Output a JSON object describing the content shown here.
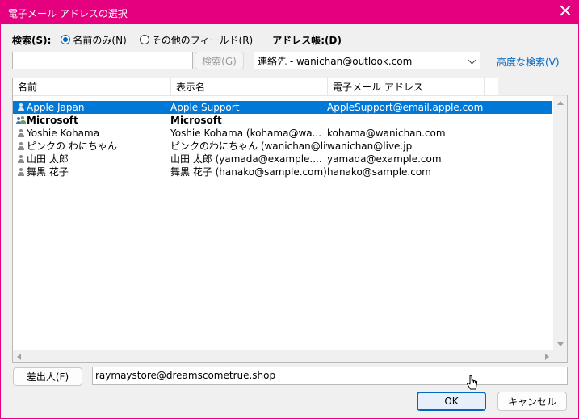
{
  "window": {
    "title": "電子メール アドレスの選択",
    "title_bar_color": "#e4007f"
  },
  "search": {
    "label": "検索(S):",
    "option_name_only": "名前のみ(N)",
    "option_other_fields": "その他のフィールド(R)",
    "selected_option": "名前のみ(N)",
    "input_value": "",
    "search_button": "検索(G)"
  },
  "address_book": {
    "label": "アドレス帳:(D)",
    "selected": "連絡先 - wanichan@outlook.com",
    "advanced_link": "高度な検索(V)"
  },
  "table": {
    "columns": [
      "名前",
      "表示名",
      "電子メール アドレス"
    ],
    "rows": [
      {
        "icon": "person-icon",
        "name": "Apple Japan",
        "display": "Apple Support",
        "email": "AppleSupport@email.apple.com",
        "selected": true,
        "bold": false
      },
      {
        "icon": "group-icon",
        "name": "Microsoft",
        "display": "Microsoft",
        "email": "",
        "selected": false,
        "bold": true
      },
      {
        "icon": "person-icon",
        "name": "Yoshie Kohama",
        "display": "Yoshie Kohama (kohama@wa...",
        "email": "kohama@wanichan.com",
        "selected": false,
        "bold": false
      },
      {
        "icon": "person-icon",
        "name": "ピンクの わにちゃん",
        "display": "ピンクのわにちゃん (wanichan@live...",
        "email": "wanichan@live.jp",
        "selected": false,
        "bold": false
      },
      {
        "icon": "person-icon",
        "name": "山田 太郎",
        "display": "山田 太郎 (yamada@example....",
        "email": "yamada@example.com",
        "selected": false,
        "bold": false
      },
      {
        "icon": "person-icon",
        "name": "舞黒 花子",
        "display": "舞黒 花子 (hanako@sample.com)",
        "email": "hanako@sample.com",
        "selected": false,
        "bold": false
      }
    ],
    "selection_color": "#0078d7"
  },
  "from": {
    "button_label": "差出人(F)",
    "value": "raymaystore@dreamscometrue.shop"
  },
  "footer": {
    "ok_label": "OK",
    "cancel_label": "キャンセル"
  },
  "colors": {
    "accent": "#0067c0",
    "dialog_bg": "#f0f0f0"
  }
}
